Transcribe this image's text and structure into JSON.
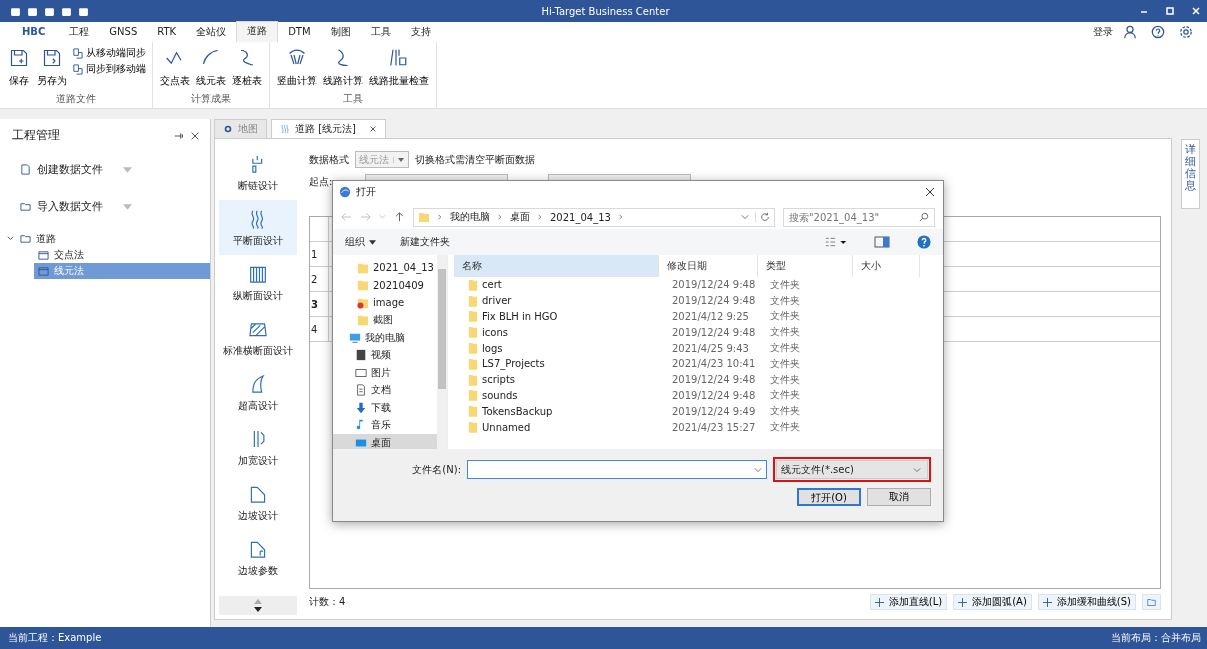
{
  "window": {
    "title": "Hi-Target Business Center"
  },
  "menu_tabs": [
    {
      "label": "HBC",
      "selected": false,
      "kind": "brand"
    },
    {
      "label": "工程",
      "selected": false,
      "kind": "tab"
    },
    {
      "label": "GNSS",
      "selected": false,
      "kind": "tab"
    },
    {
      "label": "RTK",
      "selected": false,
      "kind": "tab"
    },
    {
      "label": "全站仪",
      "selected": false,
      "kind": "tab"
    },
    {
      "label": "道路",
      "selected": true,
      "kind": "tab"
    },
    {
      "label": "DTM",
      "selected": false,
      "kind": "tab"
    },
    {
      "label": "制图",
      "selected": false,
      "kind": "tab"
    },
    {
      "label": "工具",
      "selected": false,
      "kind": "tab"
    },
    {
      "label": "支持",
      "selected": false,
      "kind": "tab"
    }
  ],
  "account": {
    "login": "登录"
  },
  "ribbon_groups": [
    {
      "label": "道路文件",
      "buttons": [
        {
          "label": "保存",
          "kind": "large"
        },
        {
          "label": "另存为",
          "kind": "large"
        },
        {
          "label": "从移动端同步",
          "kind": "small"
        },
        {
          "label": "同步到移动端",
          "kind": "small"
        }
      ]
    },
    {
      "label": "计算成果",
      "buttons": [
        {
          "label": "交点表",
          "kind": "large"
        },
        {
          "label": "线元表",
          "kind": "large"
        },
        {
          "label": "逐桩表",
          "kind": "large"
        }
      ]
    },
    {
      "label": "工具",
      "buttons": [
        {
          "label": "竖曲计算",
          "kind": "large"
        },
        {
          "label": "线路计算",
          "kind": "large"
        },
        {
          "label": "线路批量检查",
          "kind": "large"
        }
      ]
    }
  ],
  "project_panel": {
    "title": "工程管理",
    "actions": [
      {
        "label": "创建数据文件",
        "kind": "file"
      },
      {
        "label": "导入数据文件",
        "kind": "folder"
      }
    ],
    "tree": [
      {
        "label": "道路",
        "expanded": true,
        "selected": false,
        "children": [
          {
            "label": "交点法",
            "selected": false
          },
          {
            "label": "线元法",
            "selected": true
          }
        ]
      }
    ]
  },
  "doc_tabs": [
    {
      "label": "地图",
      "selected": false,
      "closable": false,
      "kind": "map"
    },
    {
      "label": "道路 [线元法]",
      "selected": true,
      "closable": true,
      "kind": "road"
    }
  ],
  "design_nav": [
    {
      "label": "断链设计",
      "selected": false
    },
    {
      "label": "平断面设计",
      "selected": true
    },
    {
      "label": "纵断面设计",
      "selected": false
    },
    {
      "label": "标准横断面设计",
      "selected": false
    },
    {
      "label": "超高设计",
      "selected": false
    },
    {
      "label": "加宽设计",
      "selected": false
    },
    {
      "label": "边坡设计",
      "selected": false
    },
    {
      "label": "边坡参数",
      "selected": false
    }
  ],
  "form": {
    "format_label": "数据格式",
    "format_value": "线元法",
    "format_disabled": true,
    "format_note": "切换格式需清空平断面数据",
    "start_label": "起点:"
  },
  "table": {
    "rows": [
      {
        "number": "1",
        "current": false
      },
      {
        "number": "2",
        "current": false
      },
      {
        "number": "3",
        "current": true
      },
      {
        "number": "4",
        "current": false
      }
    ]
  },
  "count": "计数：4",
  "add_buttons": [
    "添加直线(L)",
    "添加圆弧(A)",
    "添加缓和曲线(S)"
  ],
  "side_tab": "详细信息",
  "status_bar": {
    "project": "当前工程：Example",
    "layout": "当前布局：合并布局"
  },
  "dialog": {
    "title": "打开",
    "path": [
      "我的电脑",
      "桌面",
      "2021_04_13"
    ],
    "search_placeholder": "搜索\"2021_04_13\"",
    "organize": "组织",
    "new_folder": "新建文件夹",
    "quick_access": [
      {
        "label": "2021_04_13",
        "kind": "folder",
        "selected": false
      },
      {
        "label": "20210409",
        "kind": "folder",
        "selected": false
      },
      {
        "label": "image",
        "kind": "folder_alert",
        "selected": false
      },
      {
        "label": "截图",
        "kind": "folder",
        "selected": false
      }
    ],
    "this_pc": {
      "label": "我的电脑",
      "selected": false,
      "children": [
        {
          "label": "视频",
          "kind": "video",
          "selected": false
        },
        {
          "label": "图片",
          "kind": "pictures",
          "selected": false
        },
        {
          "label": "文档",
          "kind": "documents",
          "selected": false
        },
        {
          "label": "下载",
          "kind": "downloads",
          "selected": false
        },
        {
          "label": "音乐",
          "kind": "music",
          "selected": false
        },
        {
          "label": "桌面",
          "kind": "desktop",
          "selected": true
        }
      ]
    },
    "columns": [
      "名称",
      "修改日期",
      "类型",
      "大小"
    ],
    "files": [
      {
        "name": "cert",
        "modified": "2019/12/24 9:48",
        "type": "文件夹"
      },
      {
        "name": "driver",
        "modified": "2019/12/24 9:48",
        "type": "文件夹"
      },
      {
        "name": "Fix BLH in HGO",
        "modified": "2021/4/12 9:25",
        "type": "文件夹"
      },
      {
        "name": "icons",
        "modified": "2019/12/24 9:48",
        "type": "文件夹"
      },
      {
        "name": "logs",
        "modified": "2021/4/25 9:43",
        "type": "文件夹"
      },
      {
        "name": "LS7_Projects",
        "modified": "2021/4/23 10:41",
        "type": "文件夹"
      },
      {
        "name": "scripts",
        "modified": "2019/12/24 9:48",
        "type": "文件夹"
      },
      {
        "name": "sounds",
        "modified": "2019/12/24 9:48",
        "type": "文件夹"
      },
      {
        "name": "TokensBackup",
        "modified": "2019/12/24 9:49",
        "type": "文件夹"
      },
      {
        "name": "Unnamed",
        "modified": "2021/4/23 15:27",
        "type": "文件夹"
      }
    ],
    "filename_label": "文件名(N):",
    "filter": "线元文件(*.sec)",
    "filter_highlighted": true,
    "open_button": "打开(O)",
    "cancel_button": "取消"
  }
}
